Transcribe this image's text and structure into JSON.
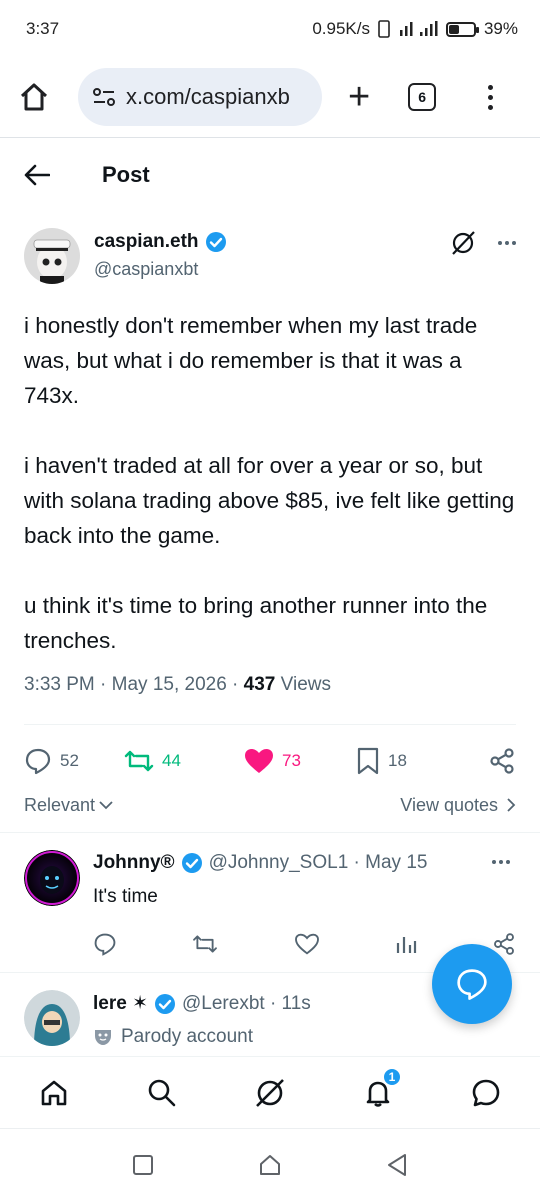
{
  "status_bar": {
    "time": "3:37",
    "net_speed": "0.95K/s",
    "battery": "39%",
    "battery_level": 0.39
  },
  "browser": {
    "url": "x.com/caspianxb",
    "tab_count": "6"
  },
  "header": {
    "title": "Post"
  },
  "post": {
    "author_name": "caspian.eth",
    "author_handle": "@caspianxbt",
    "paragraphs": [
      "i honestly don't remember when my last trade was, but what i do remember is that it was a 743x.",
      "i haven't traded at all for over a year or so, but with solana trading above $85, ive felt like getting back into the game.",
      "u think it's time to bring another runner into the trenches."
    ],
    "time": "3:33 PM · May 15, 2026 · ",
    "views_count": "437",
    "views_label": " Views",
    "stats": {
      "replies": "52",
      "reposts": "44",
      "likes": "73",
      "bookmarks": "18"
    }
  },
  "filter": {
    "sort_label": "Relevant",
    "quotes_label": "View quotes"
  },
  "replies": [
    {
      "name": "Johnny®",
      "handle": "@Johnny_SOL1 · May 15",
      "text": "It's time"
    },
    {
      "name": "lere ✶",
      "handle": "@Lerexbt · 11s",
      "text": "Parody account"
    }
  ],
  "bottom_nav": {
    "notification_badge": "1"
  },
  "colors": {
    "verified_blue": "#1d9bf0",
    "repost_green": "#00ba7c",
    "like_pink": "#f91880",
    "secondary_text": "#536471"
  }
}
